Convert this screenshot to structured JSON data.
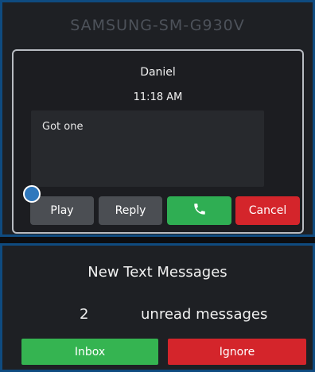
{
  "device": {
    "title": "SAMSUNG-SM-G930V"
  },
  "message": {
    "sender": "Daniel",
    "time": "11:18 AM",
    "body": "Got one"
  },
  "actions": {
    "play_label": "Play",
    "reply_label": "Reply",
    "call_icon": "phone-icon",
    "cancel_label": "Cancel"
  },
  "unread_panel": {
    "title": "New Text Messages",
    "count": "2",
    "unread_label": "unread messages",
    "inbox_label": "Inbox",
    "ignore_label": "Ignore"
  },
  "colors": {
    "accent_border": "#0f4b80",
    "call_green": "#2fae53",
    "cancel_red": "#d4252b",
    "neutral_button": "#4b4e53"
  }
}
